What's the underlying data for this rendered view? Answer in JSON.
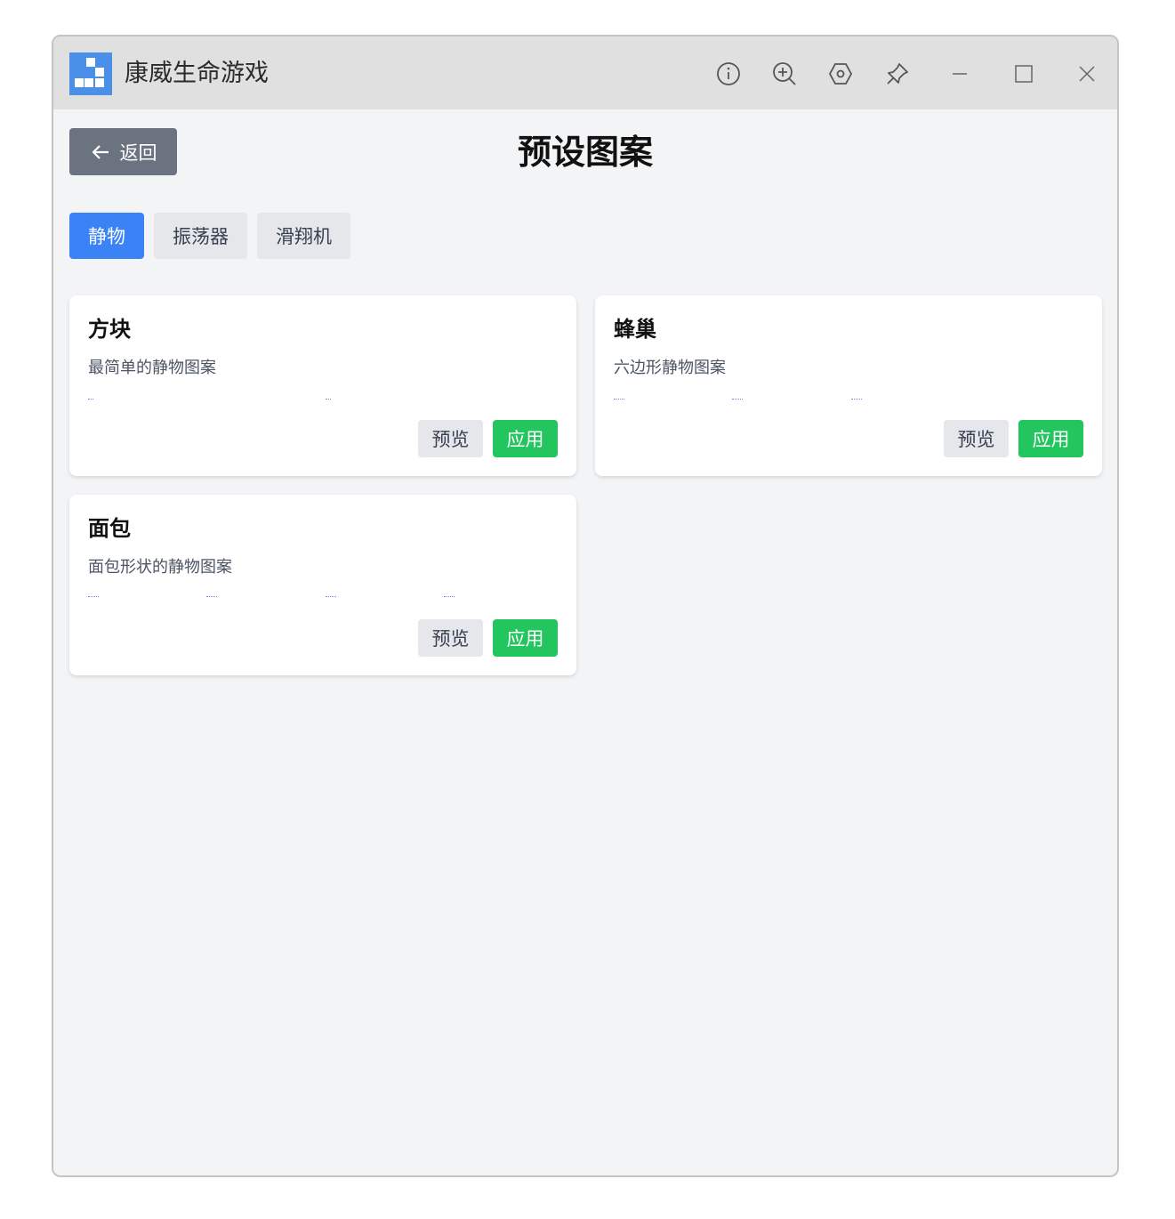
{
  "window": {
    "title": "康威生命游戏",
    "icons": [
      "info-icon",
      "zoom-in-icon",
      "settings-icon",
      "pin-icon",
      "minimize-icon",
      "maximize-icon",
      "close-icon"
    ]
  },
  "header": {
    "back_label": "返回",
    "page_title": "预设图案"
  },
  "tabs": [
    {
      "label": "静物",
      "active": true
    },
    {
      "label": "振荡器",
      "active": false
    },
    {
      "label": "滑翔机",
      "active": false
    }
  ],
  "patterns": [
    {
      "name": "方块",
      "description": "最简单的静物图案",
      "preview_label": "预览",
      "apply_label": "应用"
    },
    {
      "name": "蜂巢",
      "description": "六边形静物图案",
      "preview_label": "预览",
      "apply_label": "应用"
    },
    {
      "name": "面包",
      "description": "面包形状的静物图案",
      "preview_label": "预览",
      "apply_label": "应用"
    }
  ],
  "colors": {
    "active_tab": "#3b82f6",
    "apply_button": "#22c55e",
    "back_button": "#6b7280"
  }
}
